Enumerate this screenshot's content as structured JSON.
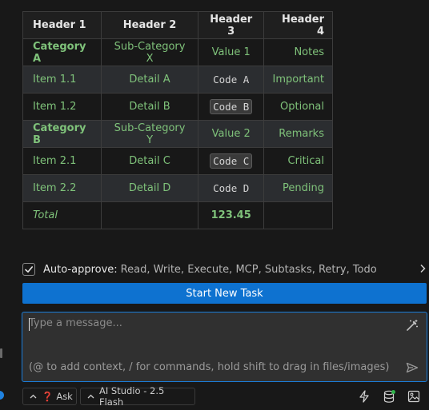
{
  "table": {
    "headers": [
      "Header 1",
      "Header 2",
      "Header 3",
      "Header 4"
    ],
    "rows": [
      {
        "c1": "Category A",
        "c2": "Sub-Category X",
        "c3": "Value 1",
        "c4": "Notes"
      },
      {
        "c1": "Item 1.1",
        "c2": "Detail A",
        "c3": "Code A",
        "c4": "Important"
      },
      {
        "c1": "Item 1.2",
        "c2": "Detail B",
        "c3": "Code B",
        "c4": "Optional"
      },
      {
        "c1": "Category B",
        "c2": "Sub-Category Y",
        "c3": "Value 2",
        "c4": "Remarks"
      },
      {
        "c1": "Item 2.1",
        "c2": "Detail C",
        "c3": "Code C",
        "c4": "Critical"
      },
      {
        "c1": "Item 2.2",
        "c2": "Detail D",
        "c3": "Code D",
        "c4": "Pending"
      }
    ],
    "total_label": "Total",
    "total_value": "123.45"
  },
  "auto_approve": {
    "checked": true,
    "label": "Auto-approve:",
    "items": "Read, Write, Execute, MCP, Subtasks, Retry, Todo"
  },
  "start_button": "Start New Task",
  "composer": {
    "placeholder": "Type a message...",
    "hint": "(@ to add context, / for commands, hold shift to drag in files/images)"
  },
  "bottom": {
    "mode_label": "Ask",
    "model_label": "AI Studio - 2.5 Flash"
  },
  "colors": {
    "accent": "#0e72d0",
    "cell_text": "#7fc27a",
    "background": "#181818"
  }
}
